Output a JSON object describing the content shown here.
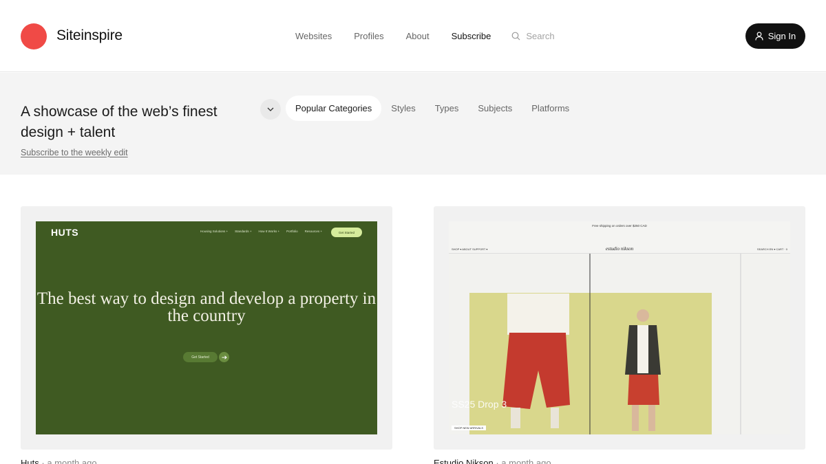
{
  "header": {
    "brand": "Siteinspire",
    "nav": [
      "Websites",
      "Profiles",
      "About",
      "Subscribe"
    ],
    "active_nav": "Subscribe",
    "search_placeholder": "Search",
    "signin_label": "Sign In",
    "logo_color": "#f04a46"
  },
  "hero": {
    "tagline": "A showcase of the web’s finest design + talent",
    "subscribe_link": "Subscribe to the weekly edit",
    "categories": [
      "Popular Categories",
      "Styles",
      "Types",
      "Subjects",
      "Platforms"
    ],
    "active_category": "Popular Categories"
  },
  "cards": [
    {
      "title": "Huts",
      "age": "a month ago",
      "screenshot": {
        "logo": "HUTS",
        "nav": [
          "Housing Solutions +",
          "Standards +",
          "How It Works +",
          "Portfolio",
          "Resources +"
        ],
        "cta": "Get Started",
        "headline": "The best way to design and develop a property in the country",
        "button": "Get Started",
        "bg_color": "#3f5a22"
      }
    },
    {
      "title": "Estudio Nikson",
      "age": "a month ago",
      "screenshot": {
        "promo": "Free shipping on orders over $250 CAD",
        "nav_left": "SHOP ▾   ABOUT   SUPPORT ▾",
        "logo": "estudio nikson",
        "nav_right": "SEARCH   EN ▾   CART · 0",
        "drop_title": "SS25 Drop 3",
        "shop_button": "SHOP NEW ARRIVALS"
      }
    }
  ]
}
